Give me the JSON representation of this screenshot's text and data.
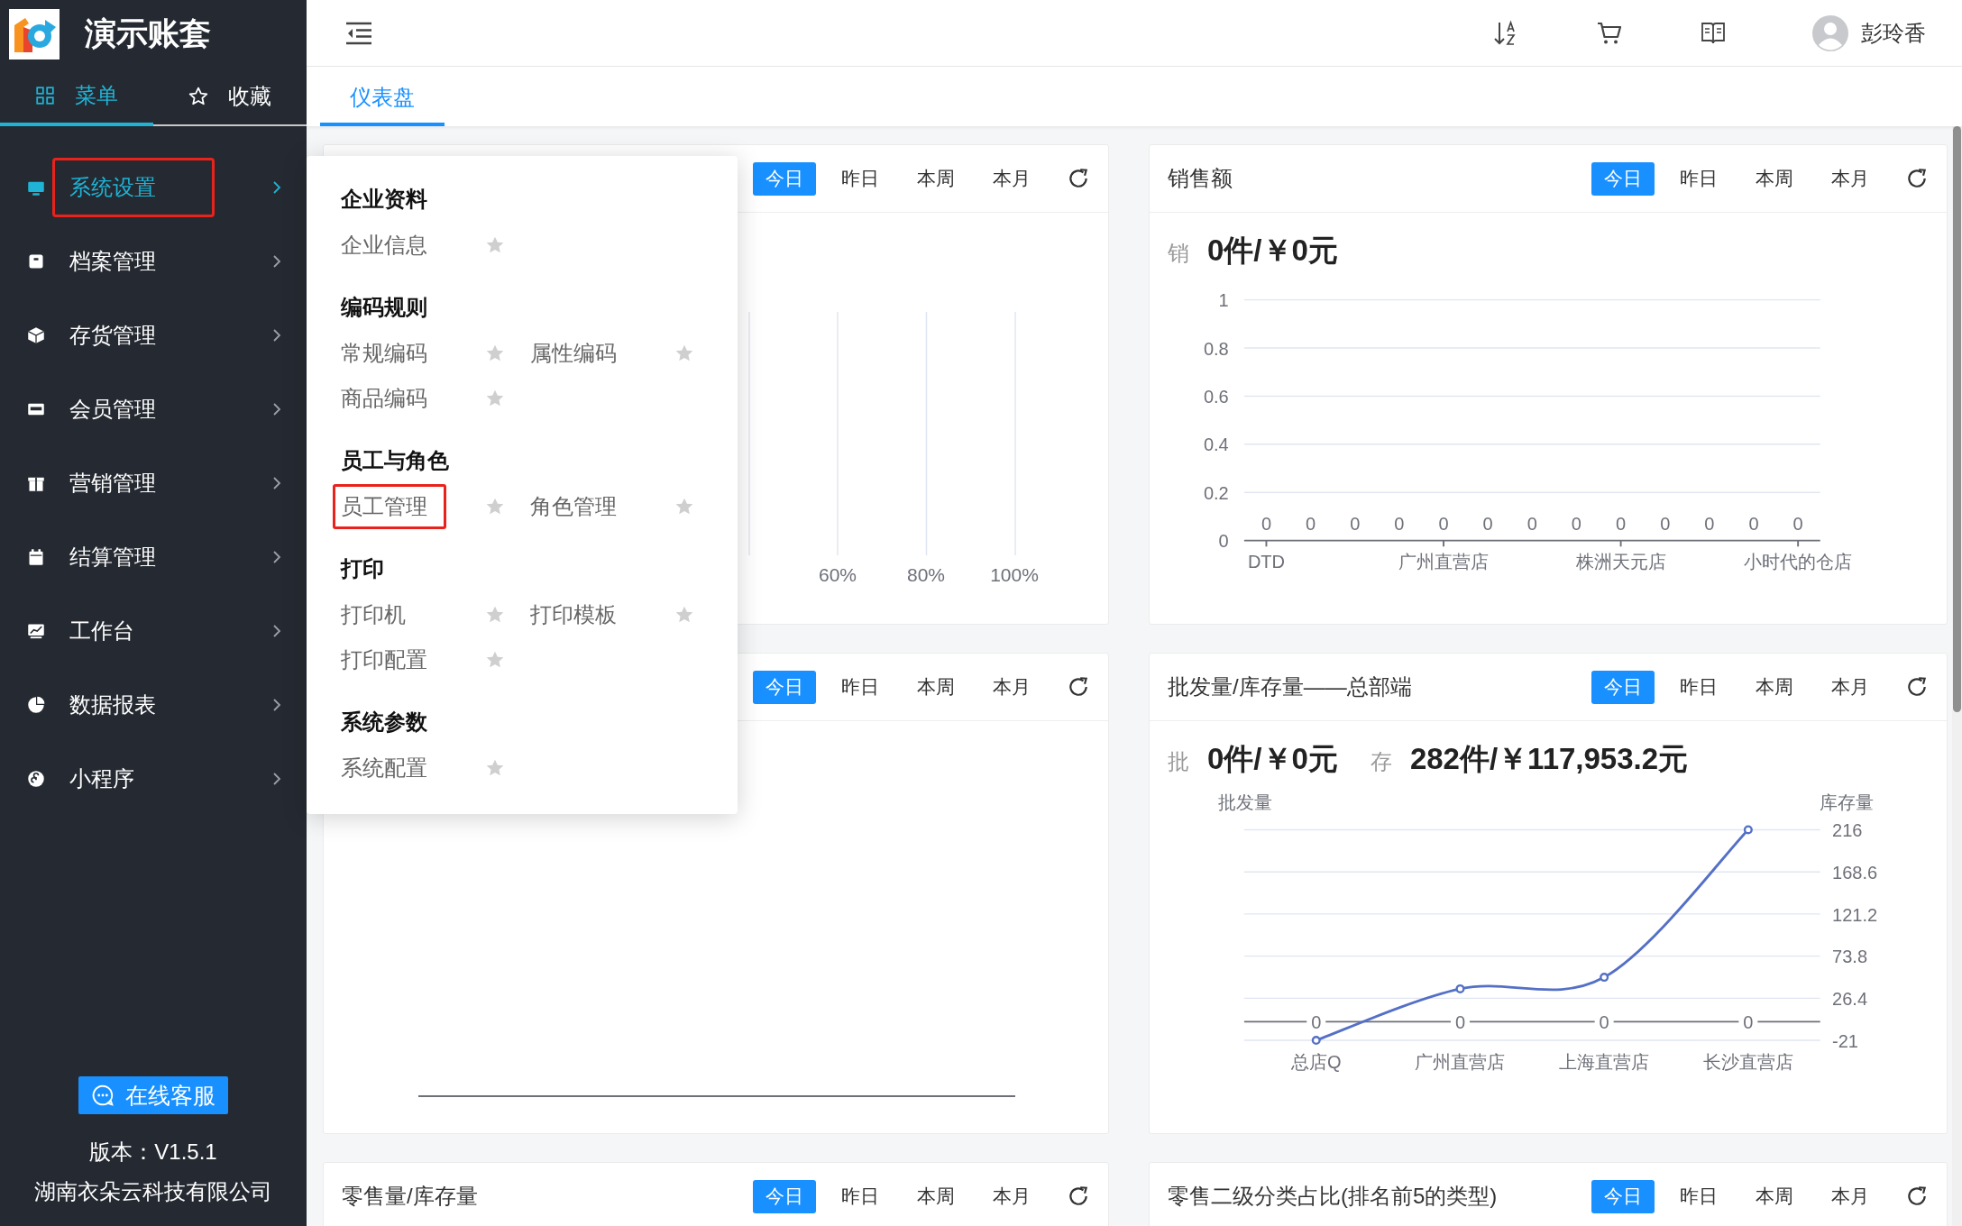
{
  "sidebar": {
    "brand": "演示账套",
    "tabs": [
      {
        "label": "菜单",
        "selected": true
      },
      {
        "label": "收藏",
        "selected": false
      }
    ],
    "menu": [
      {
        "label": "系统设置",
        "selected": true,
        "highlighted": true
      },
      {
        "label": "档案管理",
        "selected": false,
        "highlighted": false
      },
      {
        "label": "存货管理",
        "selected": false,
        "highlighted": false
      },
      {
        "label": "会员管理",
        "selected": false,
        "highlighted": false
      },
      {
        "label": "营销管理",
        "selected": false,
        "highlighted": false
      },
      {
        "label": "结算管理",
        "selected": false,
        "highlighted": false
      },
      {
        "label": "工作台",
        "selected": false,
        "highlighted": false
      },
      {
        "label": "数据报表",
        "selected": false,
        "highlighted": false
      },
      {
        "label": "小程序",
        "selected": false,
        "highlighted": false
      }
    ],
    "support_button": "在线客服",
    "version": "版本：V1.5.1",
    "company": "湖南衣朵云科技有限公司"
  },
  "topbar": {
    "user": "彭玲香"
  },
  "tabs": [
    {
      "label": "仪表盘",
      "selected": true
    }
  ],
  "flyout": {
    "groups": [
      {
        "title": "企业资料",
        "items": [
          {
            "label": "企业信息",
            "highlighted": false
          }
        ]
      },
      {
        "title": "编码规则",
        "items": [
          {
            "label": "常规编码",
            "highlighted": false
          },
          {
            "label": "属性编码",
            "highlighted": false
          },
          {
            "label": "商品编码",
            "highlighted": false
          }
        ]
      },
      {
        "title": "员工与角色",
        "items": [
          {
            "label": "员工管理",
            "highlighted": true
          },
          {
            "label": "角色管理",
            "highlighted": false
          }
        ]
      },
      {
        "title": "打印",
        "items": [
          {
            "label": "打印机",
            "highlighted": false
          },
          {
            "label": "打印模板",
            "highlighted": false
          },
          {
            "label": "打印配置",
            "highlighted": false
          }
        ]
      },
      {
        "title": "系统参数",
        "items": [
          {
            "label": "系统配置",
            "highlighted": false
          }
        ]
      }
    ]
  },
  "cards": [
    {
      "kind": "hbar-axis",
      "periods": [
        {
          "label": "今日",
          "selected": true
        },
        {
          "label": "昨日",
          "selected": false
        },
        {
          "label": "本周",
          "selected": false
        },
        {
          "label": "本月",
          "selected": false
        }
      ],
      "axis_labels": [
        "60%",
        "80%",
        "100%"
      ]
    },
    {
      "kind": "chart",
      "title": "销售额",
      "periods": [
        {
          "label": "今日",
          "selected": true
        },
        {
          "label": "昨日",
          "selected": false
        },
        {
          "label": "本周",
          "selected": false
        },
        {
          "label": "本月",
          "selected": false
        }
      ],
      "stats": [
        {
          "label": "销",
          "value": "0件/￥0元"
        }
      ],
      "chart_data": {
        "type": "bar",
        "categories": [
          "DTD",
          null,
          null,
          null,
          "广州直营店",
          null,
          null,
          null,
          "株洲天元店",
          null,
          null,
          null,
          "小时代的仓店"
        ],
        "values": [
          0,
          0,
          0,
          0,
          0,
          0,
          0,
          0,
          0,
          0,
          0,
          0,
          0
        ],
        "ylim": [
          0,
          1
        ],
        "yticks": [
          0,
          0.2,
          0.4,
          0.6,
          0.8,
          1
        ],
        "grid": true,
        "data_labels": true
      }
    },
    {
      "kind": "empty",
      "periods": [
        {
          "label": "今日",
          "selected": true
        },
        {
          "label": "昨日",
          "selected": false
        },
        {
          "label": "本周",
          "selected": false
        },
        {
          "label": "本月",
          "selected": false
        }
      ]
    },
    {
      "kind": "chart",
      "title": "批发量/库存量——总部端",
      "periods": [
        {
          "label": "今日",
          "selected": true
        },
        {
          "label": "昨日",
          "selected": false
        },
        {
          "label": "本周",
          "selected": false
        },
        {
          "label": "本月",
          "selected": false
        }
      ],
      "stats": [
        {
          "label": "批",
          "value": "0件/￥0元"
        },
        {
          "label": "存",
          "value": "282件/￥117,953.2元"
        }
      ],
      "chart_data": {
        "type": "line",
        "ylabel": "批发量",
        "y2label": "库存量",
        "categories": [
          "总店Q",
          "广州直营店",
          "上海直营店",
          "长沙直营店"
        ],
        "series": [
          {
            "color": "#6e7079",
            "values": [
              0,
              0,
              0,
              0
            ],
            "value_labels": [
              "0",
              "0",
              "0",
              "0"
            ]
          },
          {
            "color": "#5470c6",
            "values": [
              -21,
              37,
              50,
              216
            ],
            "marker": true
          }
        ],
        "ylim": [
          -21,
          216
        ],
        "yticks": [
          -21,
          26.4,
          73.8,
          121.2,
          168.6,
          216
        ],
        "grid": true
      }
    },
    {
      "kind": "header",
      "title": "零售量/库存量",
      "periods": [
        {
          "label": "今日",
          "selected": true
        },
        {
          "label": "昨日",
          "selected": false
        },
        {
          "label": "本周",
          "selected": false
        },
        {
          "label": "本月",
          "selected": false
        }
      ]
    },
    {
      "kind": "header",
      "title": "零售二级分类占比(排名前5的类型)",
      "periods": [
        {
          "label": "今日",
          "selected": true
        },
        {
          "label": "昨日",
          "selected": false
        },
        {
          "label": "本周",
          "selected": false
        },
        {
          "label": "本月",
          "selected": false
        }
      ]
    }
  ]
}
